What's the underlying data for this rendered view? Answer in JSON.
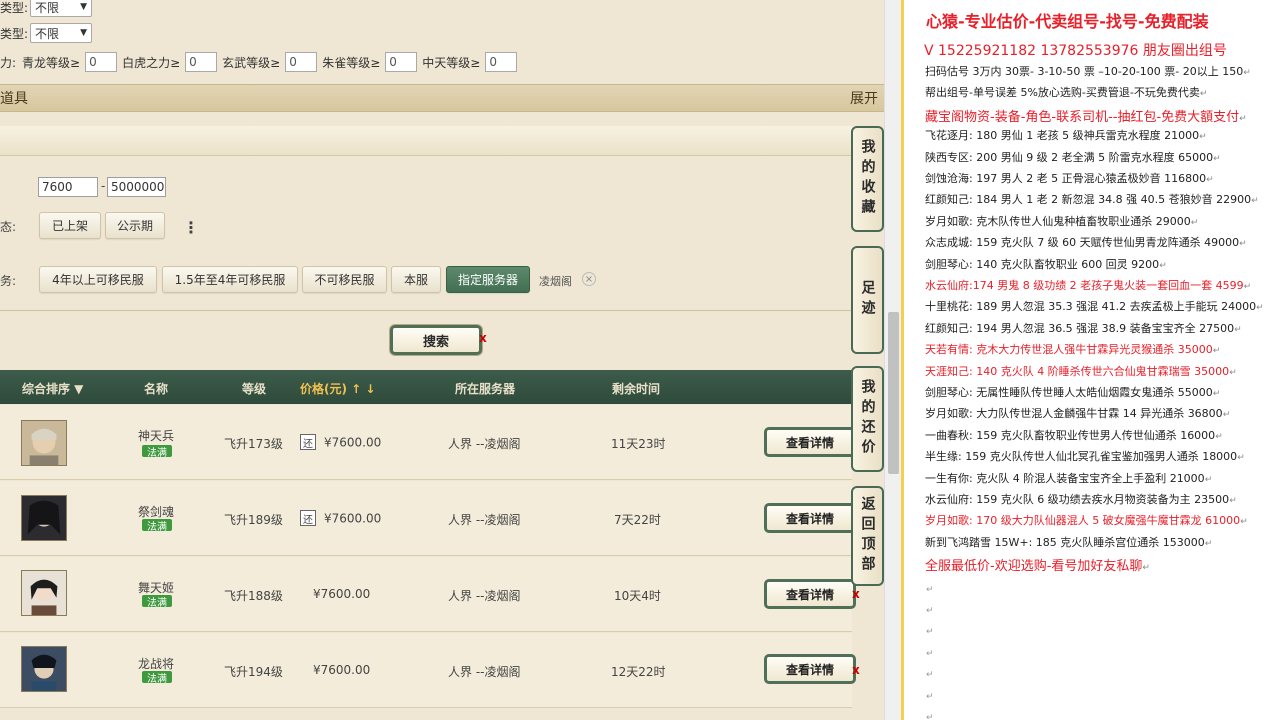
{
  "filters": {
    "type1_label": "类型:",
    "type1_value": "不限",
    "type2_label": "类型:",
    "type2_value": "不限",
    "power_label": "力:",
    "levels": [
      {
        "label": "青龙等级≥",
        "value": "0"
      },
      {
        "label": "白虎之力≥",
        "value": "0"
      },
      {
        "label": "玄武等级≥",
        "value": "0"
      },
      {
        "label": "朱雀等级≥",
        "value": "0"
      },
      {
        "label": "中天等级≥",
        "value": "0"
      }
    ]
  },
  "section": {
    "title": "道具",
    "expand": "展开"
  },
  "price_filter": {
    "min": "7600",
    "sep": "-",
    "max": "5000000"
  },
  "status": {
    "label": "态:",
    "options": [
      "已上架",
      "公示期"
    ],
    "more": "⋮"
  },
  "server": {
    "label": "务:",
    "options": [
      "4年以上可移民服",
      "1.5年至4年可移民服",
      "不可移民服",
      "本服",
      "指定服务器"
    ],
    "active": "指定服务器",
    "selected_tag": "凌烟阁",
    "remove": "×"
  },
  "search_button": "搜索",
  "table": {
    "headers": {
      "sort": "综合排序 ▼",
      "name": "名称",
      "level": "等级",
      "price": "价格(元) ↑ ↓",
      "server": "所在服务器",
      "time": "剩余时间"
    },
    "rows": [
      {
        "name": "神天兵",
        "badge": "法满",
        "level": "飞升173级",
        "haggle": "还",
        "price": "¥7600.00",
        "server": "人界 --凌烟阁",
        "time": "11天23时",
        "detail": "查看详情",
        "x": ""
      },
      {
        "name": "祭剑魂",
        "badge": "法满",
        "level": "飞升189级",
        "haggle": "还",
        "price": "¥7600.00",
        "server": "人界 --凌烟阁",
        "time": "7天22时",
        "detail": "查看详情",
        "x": ""
      },
      {
        "name": "舞天姬",
        "badge": "法满",
        "level": "飞升188级",
        "haggle": "",
        "price": "¥7600.00",
        "server": "人界 --凌烟阁",
        "time": "10天4时",
        "detail": "查看详情",
        "x": "x"
      },
      {
        "name": "龙战将",
        "badge": "法满",
        "level": "飞升194级",
        "haggle": "",
        "price": "¥7600.00",
        "server": "人界 --凌烟阁",
        "time": "12天22时",
        "detail": "查看详情",
        "x": "x"
      }
    ]
  },
  "side_tabs": [
    "我的收藏",
    "足迹",
    "我的还价",
    "返回顶部"
  ],
  "note": {
    "title": "心猿-专业估价-代卖组号-找号-免费配装",
    "phone": "V 15225921182   13782553976 朋友圈出组号",
    "lines": [
      {
        "text": "扫码估号 3万内 30票- 3-10-50 票  –10-20-100 票- 20以上 150",
        "color": "black"
      },
      {
        "text": "帮出组号-单号误差 5%放心选购-买费管退-不玩免费代卖",
        "color": "black"
      },
      {
        "text": "藏宝阁物资-装备-角色-联系司机--抽红包-免费大額支付",
        "color": "red",
        "big": true
      },
      {
        "text": "飞花逐月: 180 男仙 1 老孩 5 级神兵雷克水程度 21000",
        "color": "black"
      },
      {
        "text": "陕西专区: 200 男仙 9 级 2 老全满 5 阶雷克水程度 65000",
        "color": "black"
      },
      {
        "text": "剑蚀沧海: 197 男人 2 老 5 正骨混心猿孟极妙音 116800",
        "color": "black"
      },
      {
        "text": "红颜知己: 184 男人 1 老 2 新忽混 34.8 强 40.5 苍狼妙音 22900",
        "color": "black"
      },
      {
        "text": "岁月如歌: 克木队传世人仙鬼种植畜牧职业通杀 29000",
        "color": "black"
      },
      {
        "text": "众志成城: 159 克火队 7 级 60 天赋传世仙男青龙阵通杀 49000",
        "color": "black"
      },
      {
        "text": "剑胆琴心: 140 克火队畜牧职业 600 回灵 9200",
        "color": "black"
      },
      {
        "text": "水云仙府:174 男鬼 8 级功绩 2 老孩子鬼火装一套回血一套 4599",
        "color": "red"
      },
      {
        "text": "十里桃花: 189 男人忽混 35.3 强混 41.2 去疾孟极上手能玩 24000",
        "color": "black"
      },
      {
        "text": "红颜知己: 194 男人忽混 36.5 强混 38.9 装备宝宝齐全 27500",
        "color": "black"
      },
      {
        "text": "天若有情: 克木大力传世混人强牛甘霖异光灵猴通杀 35000",
        "color": "red"
      },
      {
        "text": "天涯知己: 140 克火队 4 阶睡杀传世六合仙鬼甘霖瑞雪 35000",
        "color": "red"
      },
      {
        "text": "剑胆琴心: 无属性睡队传世睡人太皓仙烟霞女鬼通杀 55000",
        "color": "black"
      },
      {
        "text": "岁月如歌: 大力队传世混人金麟强牛甘霖 14 异光通杀 36800",
        "color": "black"
      },
      {
        "text": "一曲春秋: 159 克火队畜牧职业传世男人传世仙通杀 16000",
        "color": "black"
      },
      {
        "text": "半生缘: 159 克火队传世人仙北冥孔雀宝鉴加强男人通杀 18000",
        "color": "black"
      },
      {
        "text": "一生有你: 克火队 4 阶混人装备宝宝齐全上手盈利 21000",
        "color": "black"
      },
      {
        "text": "水云仙府: 159 克火队 6 级功绩去疾水月物资装备为主 23500",
        "color": "black"
      },
      {
        "text": "岁月如歌: 170 级大力队仙器混人 5 破女魔强牛魔甘霖龙 61000",
        "color": "red"
      },
      {
        "text": "新到飞鸿踏雪 15W+: 185 克火队睡杀宫位通杀 153000",
        "color": "black"
      },
      {
        "text": "全服最低价-欢迎选购-看号加好友私聊",
        "color": "red",
        "big": true
      }
    ],
    "return_mark": "↵"
  },
  "colors": {
    "page_bg": "#efe7d4",
    "header_green": "#2e4a3b",
    "active_chip": "#426f52",
    "note_red": "#e8202a",
    "panel_border": "#f6d04d"
  }
}
